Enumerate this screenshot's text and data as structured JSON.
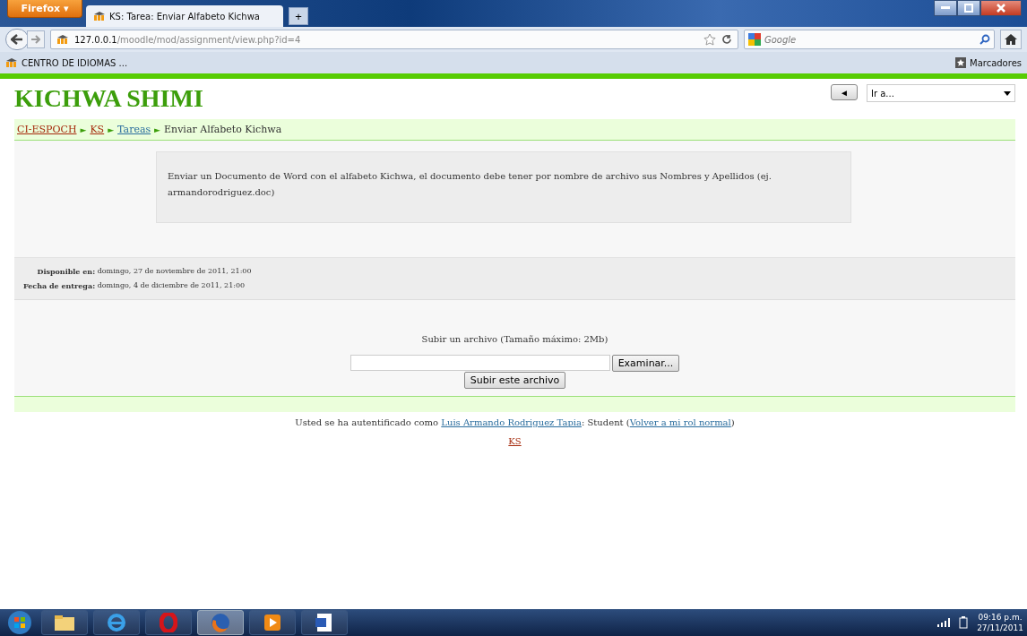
{
  "browser": {
    "menu_button": "Firefox ▾",
    "tabs": [
      {
        "title": "KS: Tarea: Enviar Alfabeto Kichwa",
        "selected": true
      }
    ],
    "new_tab": "+",
    "address": {
      "host": "127.0.0.1",
      "path": "/moodle/mod/assignment/view.php?id=4"
    },
    "search": {
      "placeholder": "Google"
    },
    "bookmarks": [
      {
        "label": "CENTRO DE IDIOMAS ..."
      }
    ],
    "bookmarks_menu": "Marcadores"
  },
  "page": {
    "site_title": "KICHWA SHIMI",
    "jump": {
      "back": "◄",
      "select": "Ir a..."
    },
    "breadcrumb": [
      {
        "label": "CI-ESPOCH",
        "kind": "link",
        "visited": true
      },
      {
        "label": "KS",
        "kind": "link",
        "visited": true
      },
      {
        "label": "Tareas",
        "kind": "link",
        "visited": false
      },
      {
        "label": "Enviar Alfabeto Kichwa",
        "kind": "current"
      }
    ],
    "separator": "►",
    "intro": "Enviar un Documento de Word con el alfabeto Kichwa, el documento debe tener por nombre de archivo sus Nombres y Apellidos (ej. armandorodriguez.doc)",
    "dates": [
      {
        "label": "Disponible en:",
        "value": "domingo, 27 de noviembre de 2011, 21:00"
      },
      {
        "label": "Fecha de entrega:",
        "value": "domingo, 4 de diciembre de 2011, 21:00"
      }
    ],
    "upload": {
      "title": "Subir un archivo (Tamaño máximo: 2Mb)",
      "browse": "Examinar...",
      "submit": "Subir este archivo"
    },
    "login_info": {
      "prefix": "Usted se ha autentificado como ",
      "user": "Luis Armando Rodriguez Tapia",
      "middle": ": Student (",
      "return": "Volver a mi rol normal",
      "suffix": ")"
    },
    "home_link": "KS"
  },
  "taskbar": {
    "apps": [
      {
        "kind": "folder",
        "selected": false
      },
      {
        "kind": "ie",
        "selected": false
      },
      {
        "kind": "opera",
        "selected": false
      },
      {
        "kind": "firefox",
        "selected": true
      },
      {
        "kind": "media",
        "selected": false
      },
      {
        "kind": "word",
        "selected": false
      }
    ],
    "time": "09:16 p.m.",
    "date": "27/11/2011"
  }
}
